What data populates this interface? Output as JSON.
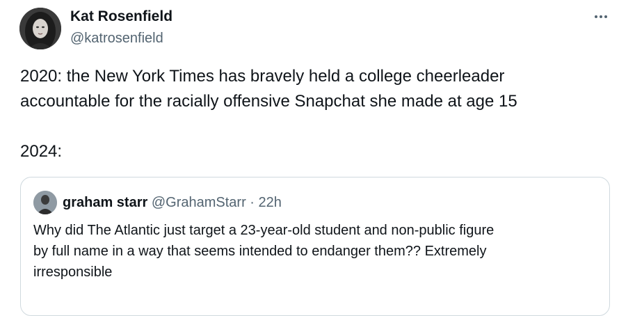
{
  "author": {
    "name": "Kat Rosenfield",
    "handle": "@katrosenfield"
  },
  "more_icon": "more-horizontal-icon",
  "tweet": {
    "lines": [
      "2020: the New York Times has bravely held a college cheerleader",
      "accountable for the racially offensive Snapchat she made at age 15",
      "2024:"
    ]
  },
  "quote": {
    "name": "graham starr",
    "handle": "@GrahamStarr",
    "separator": "·",
    "time": "22h",
    "lines": [
      "Why did The Atlantic just target a 23-year-old student and non-public figure",
      "by full name in a way that seems intended to endanger them?? Extremely",
      "irresponsible"
    ]
  },
  "colors": {
    "text_primary": "#0f1419",
    "text_secondary": "#536471",
    "border": "#cfd9de"
  }
}
